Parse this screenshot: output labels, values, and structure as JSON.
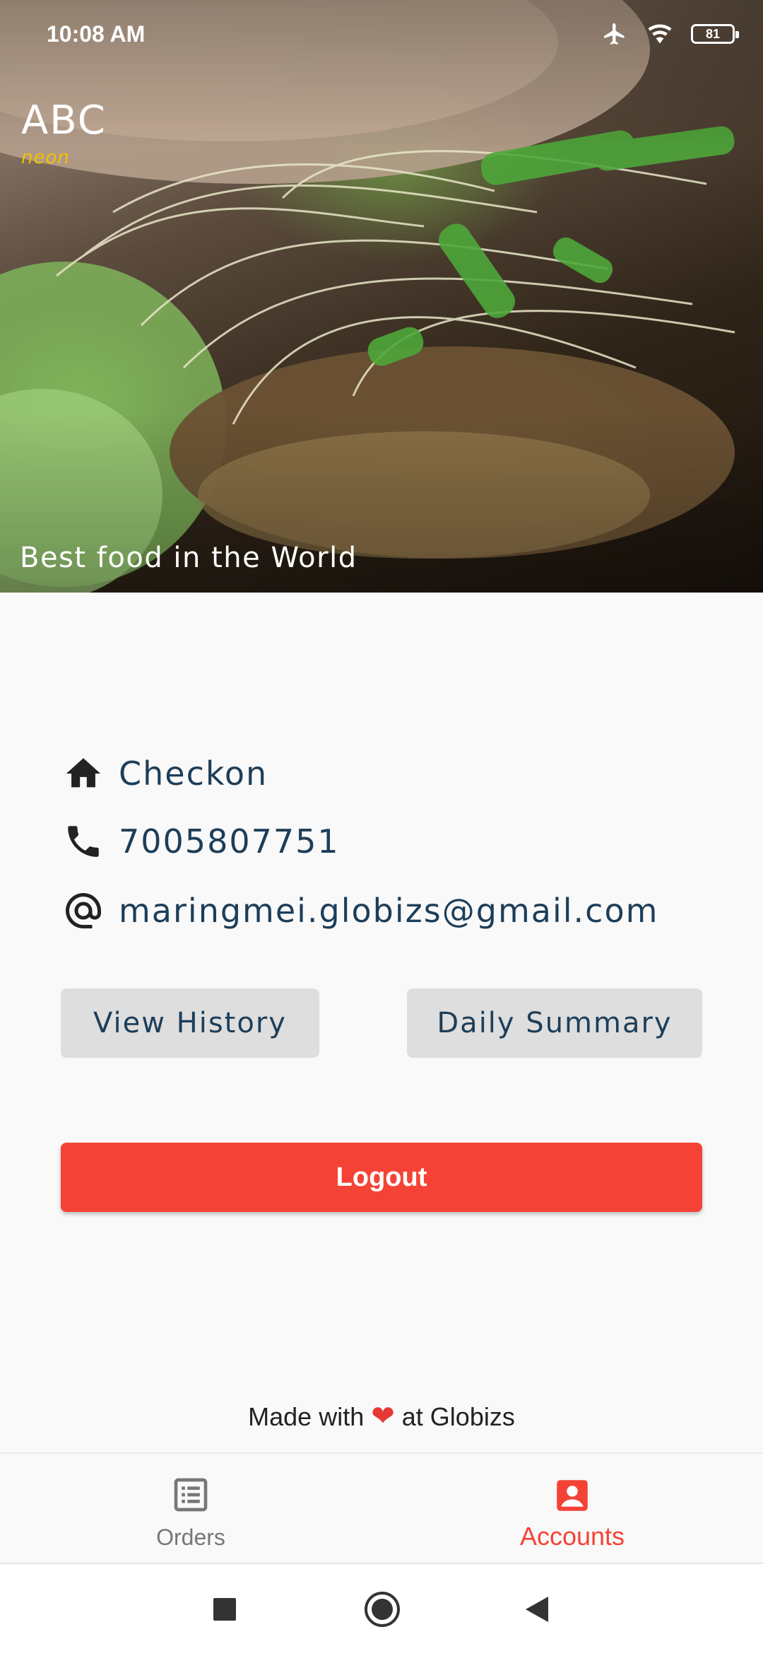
{
  "status_bar": {
    "time": "10:08 AM",
    "battery": "81",
    "icons": [
      "airplane-icon",
      "wifi-icon",
      "battery-icon"
    ]
  },
  "hero": {
    "brand_title": "ABC",
    "brand_subtitle": "neon",
    "tagline": "Best food in the World"
  },
  "account": {
    "name": "Checkon",
    "phone": "7005807751",
    "email": "maringmei.globizs@gmail.com"
  },
  "actions": {
    "view_history": "View History",
    "daily_summary": "Daily Summary",
    "logout": "Logout"
  },
  "footer": {
    "made_with": "Made with",
    "heart": "❤",
    "at": "at Globizs"
  },
  "bottom_nav": {
    "items": [
      {
        "label": "Orders",
        "icon": "list-icon",
        "active": false
      },
      {
        "label": "Accounts",
        "icon": "account-box-icon",
        "active": true
      }
    ]
  },
  "colors": {
    "accent": "#f44336",
    "text_primary": "#1d3e59",
    "button_grey": "#dedede",
    "brand_yellow": "#f2c200"
  }
}
